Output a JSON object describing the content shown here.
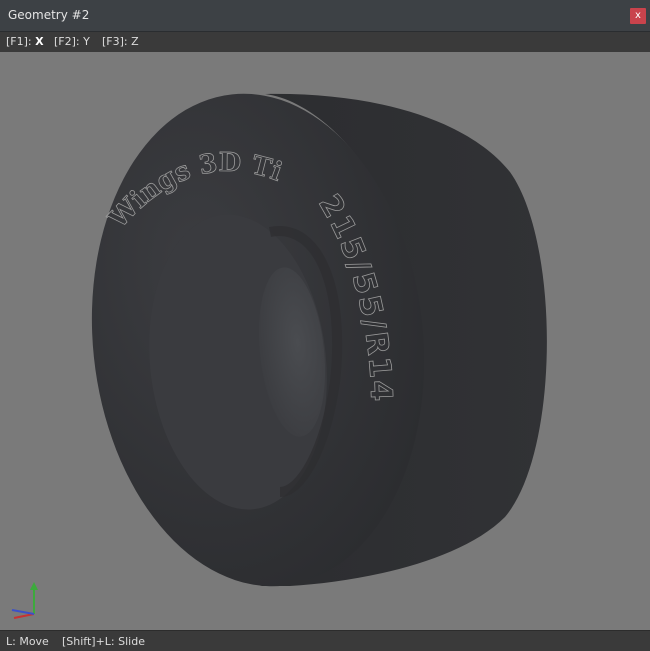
{
  "window": {
    "title": "Geometry #2",
    "close_label": "x"
  },
  "hints": [
    {
      "key": "[F1]:",
      "label": "X"
    },
    {
      "key": "[F2]:",
      "label": "Y"
    },
    {
      "key": "[F3]:",
      "label": "Z"
    }
  ],
  "tire": {
    "brand_text": "Wings 3D Tire",
    "size_text": "215/55/R14"
  },
  "status": {
    "left": "L: Move",
    "right": "[Shift]+L: Slide"
  },
  "colors": {
    "viewport_bg": "#7a7a7a",
    "tire_body": "#2f3033",
    "titlebar": "#3d4145",
    "close": "#c9434c"
  }
}
